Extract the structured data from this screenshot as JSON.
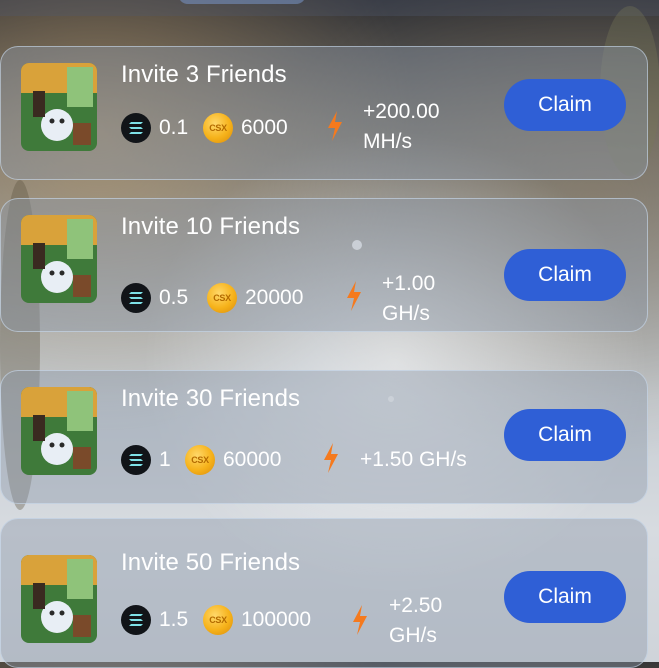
{
  "colors": {
    "claim_button": "#2f5fd6",
    "bolt": "#f57a1e",
    "coin": "#f6b21a",
    "sol_badge": "#111418"
  },
  "invites": [
    {
      "title": "Invite 3 Friends",
      "sol_amount": "0.1",
      "coin_label": "CSX",
      "coin_amount": "6000",
      "rate_line1": "+200.00",
      "rate_line2": "MH/s",
      "claim_label": "Claim",
      "thumb_icon": "game-character-thumbnail"
    },
    {
      "title": "Invite 10 Friends",
      "sol_amount": "0.5",
      "coin_label": "CSX",
      "coin_amount": "20000",
      "rate_line1": "+1.00",
      "rate_line2": "GH/s",
      "claim_label": "Claim",
      "thumb_icon": "game-character-thumbnail"
    },
    {
      "title": "Invite 30 Friends",
      "sol_amount": "1",
      "coin_label": "CSX",
      "coin_amount": "60000",
      "rate_line1": "+1.50 GH/s",
      "rate_line2": "",
      "claim_label": "Claim",
      "thumb_icon": "game-character-thumbnail"
    },
    {
      "title": "Invite 50 Friends",
      "sol_amount": "1.5",
      "coin_label": "CSX",
      "coin_amount": "100000",
      "rate_line1": "+2.50",
      "rate_line2": "GH/s",
      "claim_label": "Claim",
      "thumb_icon": "game-character-thumbnail"
    }
  ]
}
